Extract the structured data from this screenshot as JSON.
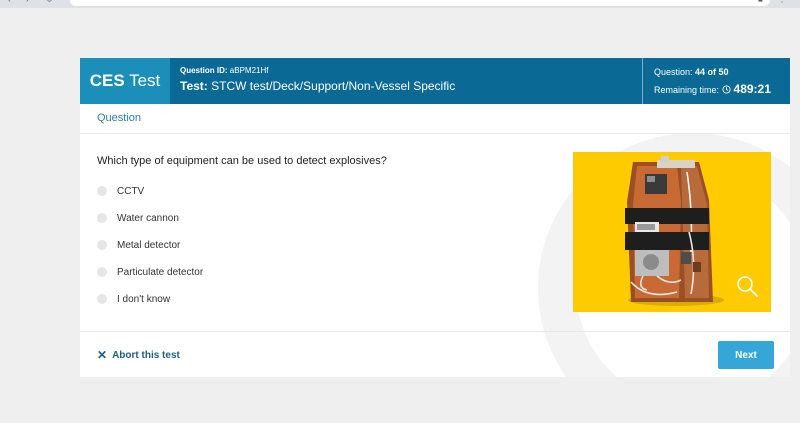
{
  "header": {
    "brand_bold": "CES",
    "brand_rest": " Test",
    "question_id_label": "Question ID: ",
    "question_id": "aBPM21Hf",
    "test_label": "Test: ",
    "test_path": "STCW test/Deck/Support/Non-Vessel Specific",
    "question_label": "Question: ",
    "question_progress": "44 of 50",
    "remaining_label": "Remaining time: ",
    "remaining_time": "489:21"
  },
  "section_label": "Question",
  "question": {
    "text": "Which type of equipment can be used to detect explosives?",
    "options": [
      "CCTV",
      "Water cannon",
      "Metal detector",
      "Particulate detector",
      "I don't know"
    ],
    "selected": null
  },
  "footer": {
    "abort_label": "Abort this test",
    "next_label": "Next"
  },
  "colors": {
    "header_bg": "#0a6a95",
    "brand_bg": "#1b8fb9",
    "accent": "#34a7d8",
    "figure_bg": "#fecb00"
  },
  "icons": {
    "clock": "clock-icon",
    "zoom": "magnifier-icon",
    "abort": "close-icon"
  }
}
